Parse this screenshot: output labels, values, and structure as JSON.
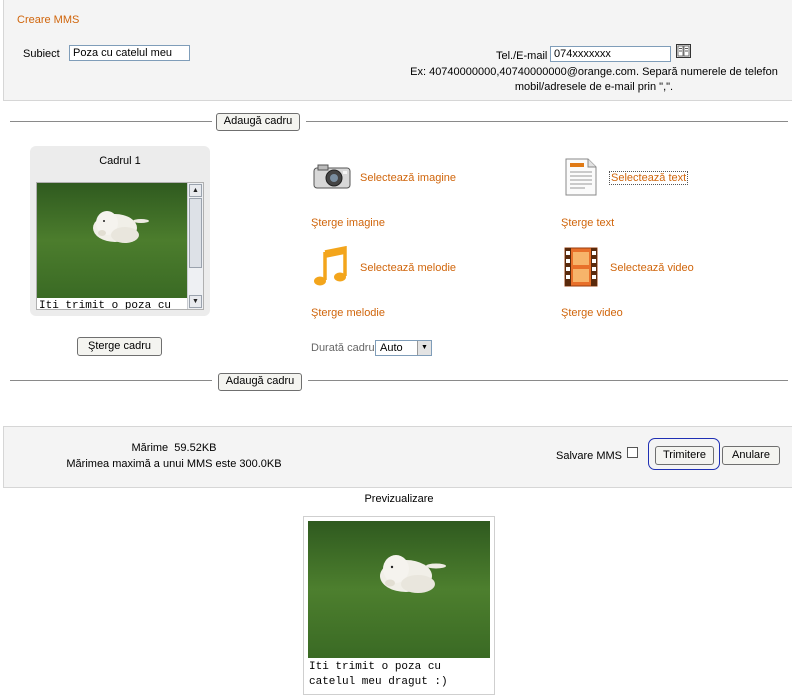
{
  "header": {
    "title": "Creare MMS"
  },
  "subject": {
    "label": "Subiect",
    "value": "Poza cu catelul meu"
  },
  "recipient": {
    "label": "Tel./E-mail",
    "value": "074xxxxxxx",
    "icon": "address-book-icon",
    "hint_line1": "Ex: 40740000000,40740000000@orange.com. Separă numerele de telefon",
    "hint_line2": "mobil/adresele de e-mail prin \",\"."
  },
  "add_frame_label": "Adaugă cadru",
  "frame": {
    "title": "Cadrul 1",
    "text_preview": "Iti trimit o poza cu",
    "delete_label": "Şterge cadru"
  },
  "actions": {
    "select_image": "Selectează imagine",
    "delete_image": "Şterge imagine",
    "select_text": "Selectează text",
    "delete_text": "Şterge text",
    "select_melody": "Selectează melodie",
    "delete_melody": "Şterge melodie",
    "select_video": "Selectează video",
    "delete_video": "Şterge video"
  },
  "duration": {
    "label": "Durată cadru",
    "value": "Auto"
  },
  "size": {
    "label": "Mărime",
    "value": "59.52KB",
    "max_text": "Mărimea maximă a unui MMS este 300.0KB"
  },
  "save": {
    "label": "Salvare MMS",
    "checked": false
  },
  "buttons": {
    "send": "Trimitere",
    "cancel": "Anulare"
  },
  "preview": {
    "title": "Previzualizare",
    "text_line1": "Iti trimit o poza cu",
    "text_line2": "catelul meu dragut :)"
  },
  "colors": {
    "link": "#d0650b",
    "panel": "#f4f4f4",
    "focus_ring": "#1f2fb4"
  }
}
